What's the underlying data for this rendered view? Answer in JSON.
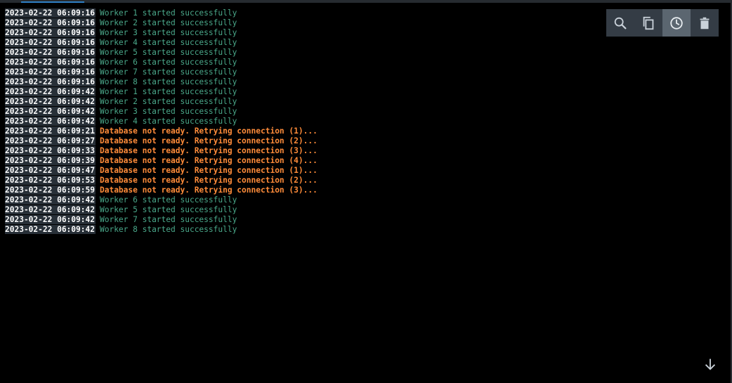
{
  "toolbar": {
    "buttons": [
      {
        "icon": "search-icon"
      },
      {
        "icon": "copy-icon"
      },
      {
        "icon": "clock-icon",
        "active": true
      },
      {
        "icon": "trash-icon"
      }
    ]
  },
  "colors": {
    "background": "#000000",
    "timestamp_bg": "#283038",
    "success_text": "#4aa88a",
    "warning_text": "#ff8c3a",
    "toolbar_bg": "#343c45",
    "toolbar_active_bg": "#5b6670",
    "accent": "#2f80c6"
  },
  "log": {
    "lines": [
      {
        "timestamp": "2023-02-22 06:09:16",
        "message": "Worker 1 started successfully",
        "level": "ok"
      },
      {
        "timestamp": "2023-02-22 06:09:16",
        "message": "Worker 2 started successfully",
        "level": "ok"
      },
      {
        "timestamp": "2023-02-22 06:09:16",
        "message": "Worker 3 started successfully",
        "level": "ok"
      },
      {
        "timestamp": "2023-02-22 06:09:16",
        "message": "Worker 4 started successfully",
        "level": "ok"
      },
      {
        "timestamp": "2023-02-22 06:09:16",
        "message": "Worker 5 started successfully",
        "level": "ok"
      },
      {
        "timestamp": "2023-02-22 06:09:16",
        "message": "Worker 6 started successfully",
        "level": "ok"
      },
      {
        "timestamp": "2023-02-22 06:09:16",
        "message": "Worker 7 started successfully",
        "level": "ok"
      },
      {
        "timestamp": "2023-02-22 06:09:16",
        "message": "Worker 8 started successfully",
        "level": "ok"
      },
      {
        "timestamp": "2023-02-22 06:09:42",
        "message": "Worker 1 started successfully",
        "level": "ok"
      },
      {
        "timestamp": "2023-02-22 06:09:42",
        "message": "Worker 2 started successfully",
        "level": "ok"
      },
      {
        "timestamp": "2023-02-22 06:09:42",
        "message": "Worker 3 started successfully",
        "level": "ok"
      },
      {
        "timestamp": "2023-02-22 06:09:42",
        "message": "Worker 4 started successfully",
        "level": "ok"
      },
      {
        "timestamp": "2023-02-22 06:09:21",
        "message": "Database not ready. Retrying connection (1)...",
        "level": "warn"
      },
      {
        "timestamp": "2023-02-22 06:09:27",
        "message": "Database not ready. Retrying connection (2)...",
        "level": "warn"
      },
      {
        "timestamp": "2023-02-22 06:09:33",
        "message": "Database not ready. Retrying connection (3)...",
        "level": "warn"
      },
      {
        "timestamp": "2023-02-22 06:09:39",
        "message": "Database not ready. Retrying connection (4)...",
        "level": "warn"
      },
      {
        "timestamp": "2023-02-22 06:09:47",
        "message": "Database not ready. Retrying connection (1)...",
        "level": "warn"
      },
      {
        "timestamp": "2023-02-22 06:09:53",
        "message": "Database not ready. Retrying connection (2)...",
        "level": "warn"
      },
      {
        "timestamp": "2023-02-22 06:09:59",
        "message": "Database not ready. Retrying connection (3)...",
        "level": "warn"
      },
      {
        "timestamp": "2023-02-22 06:09:42",
        "message": "Worker 6 started successfully",
        "level": "ok"
      },
      {
        "timestamp": "2023-02-22 06:09:42",
        "message": "Worker 5 started successfully",
        "level": "ok"
      },
      {
        "timestamp": "2023-02-22 06:09:42",
        "message": "Worker 7 started successfully",
        "level": "ok"
      },
      {
        "timestamp": "2023-02-22 06:09:42",
        "message": "Worker 8 started successfully",
        "level": "ok"
      }
    ]
  },
  "scroll": {
    "icon": "arrow-down-icon"
  }
}
